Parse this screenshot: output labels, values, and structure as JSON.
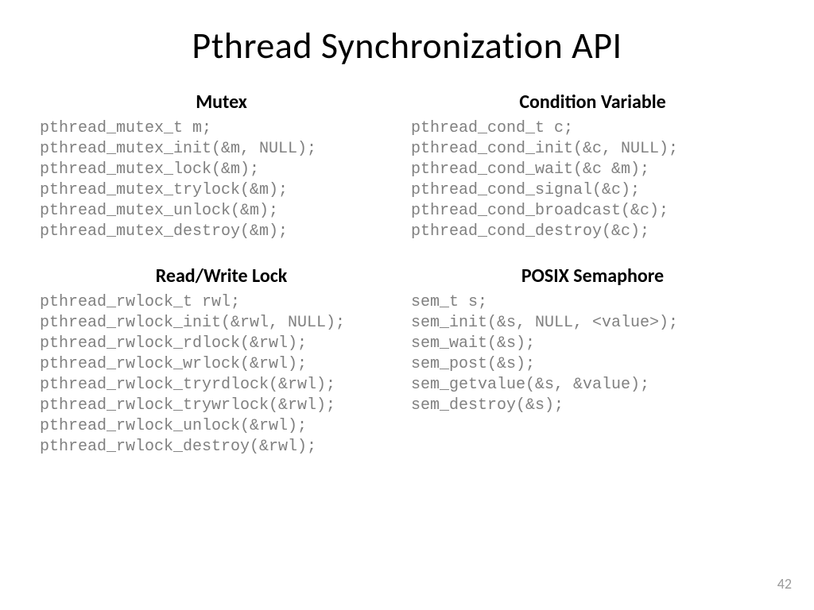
{
  "title": "Pthread Synchronization API",
  "page_number": "42",
  "sections": {
    "mutex": {
      "heading": "Mutex",
      "code": "pthread_mutex_t m;\npthread_mutex_init(&m, NULL);\npthread_mutex_lock(&m);\npthread_mutex_trylock(&m);\npthread_mutex_unlock(&m);\npthread_mutex_destroy(&m);"
    },
    "cond": {
      "heading": "Condition Variable",
      "code": "pthread_cond_t c;\npthread_cond_init(&c, NULL);\npthread_cond_wait(&c &m);\npthread_cond_signal(&c);\npthread_cond_broadcast(&c);\npthread_cond_destroy(&c);"
    },
    "rwlock": {
      "heading": "Read/Write Lock",
      "code": "pthread_rwlock_t rwl;\npthread_rwlock_init(&rwl, NULL);\npthread_rwlock_rdlock(&rwl);\npthread_rwlock_wrlock(&rwl);\npthread_rwlock_tryrdlock(&rwl);\npthread_rwlock_trywrlock(&rwl);\npthread_rwlock_unlock(&rwl);\npthread_rwlock_destroy(&rwl);"
    },
    "sem": {
      "heading": "POSIX Semaphore",
      "code": "sem_t s;\nsem_init(&s, NULL, <value>);\nsem_wait(&s);\nsem_post(&s);\nsem_getvalue(&s, &value);\nsem_destroy(&s);"
    }
  }
}
